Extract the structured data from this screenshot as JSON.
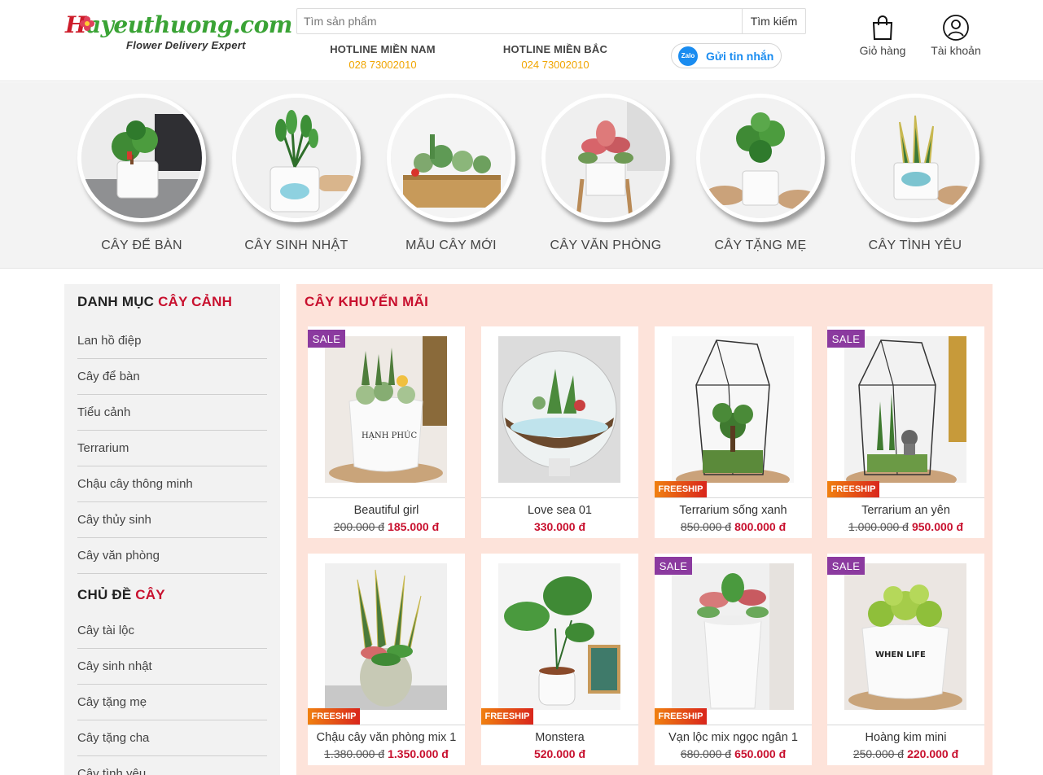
{
  "header": {
    "logo": {
      "main_start": "H",
      "main_rest": "ayeuthuong.com",
      "tagline": "Flower Delivery Expert"
    },
    "search": {
      "placeholder": "Tìm sản phẩm",
      "button": "Tìm kiếm"
    },
    "hotlines": [
      {
        "title": "HOTLINE MIỀN NAM",
        "number": "028 73002010"
      },
      {
        "title": "HOTLINE MIỀN BẮC",
        "number": "024 73002010"
      }
    ],
    "zalo": {
      "icon_text": "Zalo",
      "label": "Gửi tin nhắn"
    },
    "cart_label": "Giỏ hàng",
    "account_label": "Tài khoản"
  },
  "categories": [
    {
      "label": "CÂY ĐỂ BÀN"
    },
    {
      "label": "CÂY SINH NHẬT"
    },
    {
      "label": "MẪU CÂY MỚI"
    },
    {
      "label": "CÂY VĂN PHÒNG"
    },
    {
      "label": "CÂY TẶNG MẸ"
    },
    {
      "label": "CÂY TÌNH YÊU"
    }
  ],
  "sidebar": {
    "heading1": {
      "text": "DANH MỤC ",
      "highlight": "CÂY CẢNH"
    },
    "items1": [
      "Lan hồ điệp",
      "Cây để bàn",
      "Tiểu cảnh",
      "Terrarium",
      "Chậu cây thông minh",
      "Cây thủy sinh",
      "Cây văn phòng"
    ],
    "heading2": {
      "text": "CHỦ ĐỀ ",
      "highlight": "CÂY"
    },
    "items2": [
      "Cây tài lộc",
      "Cây sinh nhật",
      "Cây tặng mẹ",
      "Cây tặng cha",
      "Cây tình yêu"
    ]
  },
  "main": {
    "title": "CÂY KHUYẾN MÃI",
    "sale_label": "SALE",
    "freeship_label": "FREESHIP",
    "products": [
      {
        "name": "Beautiful girl",
        "old_price": "200.000 đ",
        "price": "185.000 đ",
        "sale": true,
        "freeship": false
      },
      {
        "name": "Love sea 01",
        "old_price": "",
        "price": "330.000 đ",
        "sale": false,
        "freeship": false
      },
      {
        "name": "Terrarium sống xanh",
        "old_price": "850.000 đ",
        "price": "800.000 đ",
        "sale": false,
        "freeship": true
      },
      {
        "name": "Terrarium an yên",
        "old_price": "1.000.000 đ",
        "price": "950.000 đ",
        "sale": true,
        "freeship": true
      },
      {
        "name": "Chậu cây văn phòng mix 1",
        "old_price": "1.380.000 đ",
        "price": "1.350.000 đ",
        "sale": false,
        "freeship": true
      },
      {
        "name": "Monstera",
        "old_price": "",
        "price": "520.000 đ",
        "sale": false,
        "freeship": true
      },
      {
        "name": "Vạn lộc mix ngọc ngân 1",
        "old_price": "680.000 đ",
        "price": "650.000 đ",
        "sale": true,
        "freeship": true
      },
      {
        "name": "Hoàng kim mini",
        "old_price": "250.000 đ",
        "price": "220.000 đ",
        "sale": true,
        "freeship": false
      }
    ]
  },
  "colors": {
    "brand_red": "#c8102e",
    "brand_green": "#3aa335",
    "hotline_orange": "#f0a500",
    "zalo_blue": "#1a8cf0",
    "sale_purple": "#8b3a9f",
    "promo_bg": "#fde3da"
  }
}
